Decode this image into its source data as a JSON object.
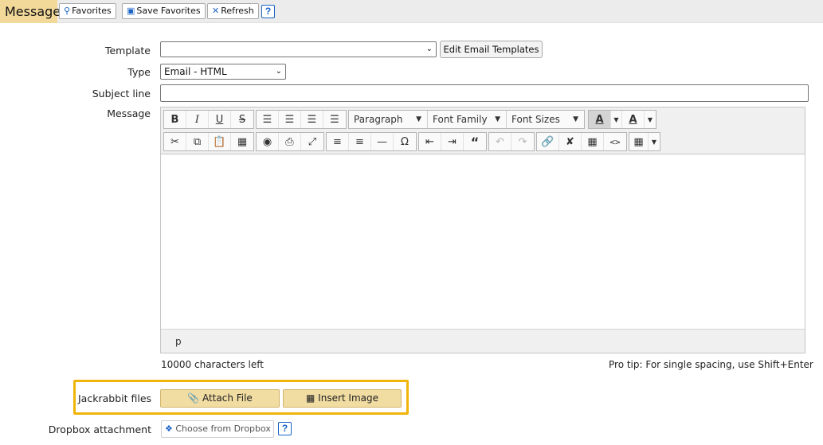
{
  "header": {
    "title": "Message",
    "favorites_label": "Favorites",
    "save_favorites_label": "Save Favorites",
    "refresh_label": "Refresh",
    "help_label": "?"
  },
  "form": {
    "template_label": "Template",
    "template_value": "",
    "edit_templates_label": "Edit Email Templates",
    "type_label": "Type",
    "type_value": "Email - HTML",
    "subject_label": "Subject line",
    "subject_value": "",
    "message_label": "Message"
  },
  "editor": {
    "paragraph_label": "Paragraph",
    "font_family_label": "Font Family",
    "font_sizes_label": "Font Sizes",
    "bold": "B",
    "italic": "I",
    "underline": "U",
    "strikethrough": "S",
    "text_color_letter": "A",
    "bg_color_letter": "A",
    "special_char": "Ω",
    "status_path": "p"
  },
  "footer": {
    "chars_left": "10000 characters left",
    "pro_tip": "Pro tip: For single spacing, use Shift+Enter",
    "jackrabbit_label": "Jackrabbit files",
    "attach_file_label": "Attach File",
    "insert_image_label": "Insert Image",
    "dropbox_label": "Dropbox attachment",
    "choose_dropbox_label": "Choose from Dropbox",
    "help_label": "?"
  },
  "colors": {
    "accent_blue": "#1a63c4",
    "title_bg": "#f2d99a",
    "highlight_border": "#f0b40a",
    "gold_button": "#f1dca2"
  }
}
